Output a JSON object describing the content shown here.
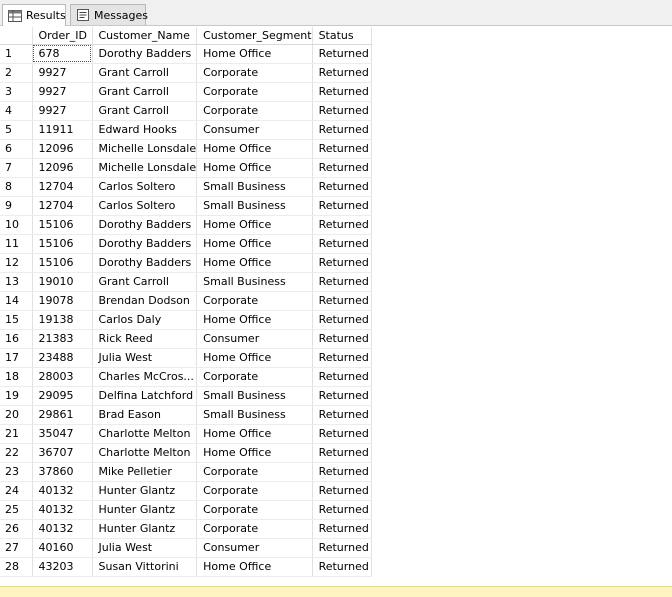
{
  "tabs": [
    {
      "label": "Results",
      "icon": "grid-icon",
      "active": true
    },
    {
      "label": "Messages",
      "icon": "messages-icon",
      "active": false
    }
  ],
  "columns": [
    "",
    "Order_ID",
    "Customer_Name",
    "Customer_Segment",
    "Status"
  ],
  "rows": [
    [
      "1",
      "678",
      "Dorothy Badders",
      "Home Office",
      "Returned"
    ],
    [
      "2",
      "9927",
      "Grant Carroll",
      "Corporate",
      "Returned"
    ],
    [
      "3",
      "9927",
      "Grant Carroll",
      "Corporate",
      "Returned"
    ],
    [
      "4",
      "9927",
      "Grant Carroll",
      "Corporate",
      "Returned"
    ],
    [
      "5",
      "11911",
      "Edward Hooks",
      "Consumer",
      "Returned"
    ],
    [
      "6",
      "12096",
      "Michelle Lonsdale",
      "Home Office",
      "Returned"
    ],
    [
      "7",
      "12096",
      "Michelle Lonsdale",
      "Home Office",
      "Returned"
    ],
    [
      "8",
      "12704",
      "Carlos Soltero",
      "Small Business",
      "Returned"
    ],
    [
      "9",
      "12704",
      "Carlos Soltero",
      "Small Business",
      "Returned"
    ],
    [
      "10",
      "15106",
      "Dorothy Badders",
      "Home Office",
      "Returned"
    ],
    [
      "11",
      "15106",
      "Dorothy Badders",
      "Home Office",
      "Returned"
    ],
    [
      "12",
      "15106",
      "Dorothy Badders",
      "Home Office",
      "Returned"
    ],
    [
      "13",
      "19010",
      "Grant Carroll",
      "Small Business",
      "Returned"
    ],
    [
      "14",
      "19078",
      "Brendan Dodson",
      "Corporate",
      "Returned"
    ],
    [
      "15",
      "19138",
      "Carlos Daly",
      "Home Office",
      "Returned"
    ],
    [
      "16",
      "21383",
      "Rick Reed",
      "Consumer",
      "Returned"
    ],
    [
      "17",
      "23488",
      "Julia West",
      "Home Office",
      "Returned"
    ],
    [
      "18",
      "28003",
      "Charles McCros...",
      "Corporate",
      "Returned"
    ],
    [
      "19",
      "29095",
      "Delfina Latchford",
      "Small Business",
      "Returned"
    ],
    [
      "20",
      "29861",
      "Brad Eason",
      "Small Business",
      "Returned"
    ],
    [
      "21",
      "35047",
      "Charlotte Melton",
      "Home Office",
      "Returned"
    ],
    [
      "22",
      "36707",
      "Charlotte Melton",
      "Home Office",
      "Returned"
    ],
    [
      "23",
      "37860",
      "Mike Pelletier",
      "Corporate",
      "Returned"
    ],
    [
      "24",
      "40132",
      "Hunter Glantz",
      "Corporate",
      "Returned"
    ],
    [
      "25",
      "40132",
      "Hunter Glantz",
      "Corporate",
      "Returned"
    ],
    [
      "26",
      "40132",
      "Hunter Glantz",
      "Corporate",
      "Returned"
    ],
    [
      "27",
      "40160",
      "Julia West",
      "Consumer",
      "Returned"
    ],
    [
      "28",
      "43203",
      "Susan Vittorini",
      "Home Office",
      "Returned"
    ]
  ]
}
